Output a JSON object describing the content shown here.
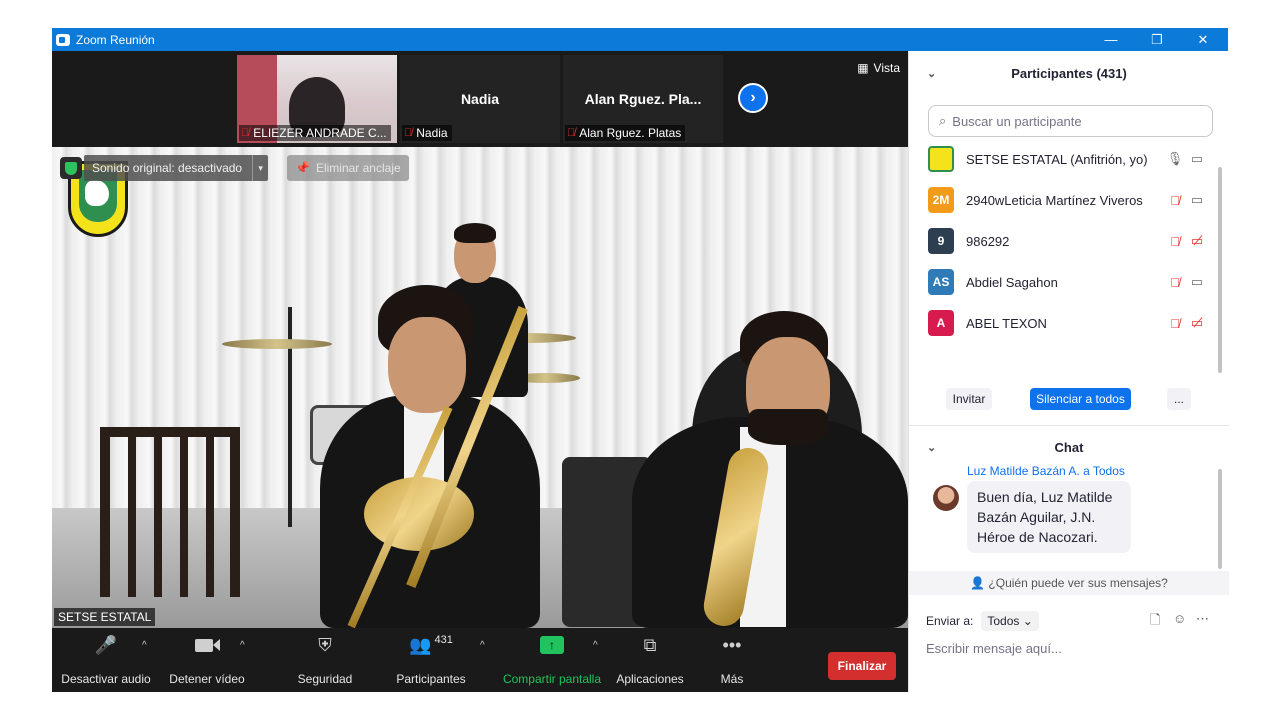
{
  "window": {
    "title": "Zoom Reunión",
    "minimize": "—",
    "restore": "❐",
    "close": "✕"
  },
  "strip": {
    "tiles": [
      {
        "name": "ELIEZER ANDRADE C...",
        "big": ""
      },
      {
        "name": "Nadia",
        "big": "Nadia"
      },
      {
        "name": "Alan  Rguez. Platas",
        "big": "Alan  Rguez. Pla..."
      }
    ],
    "next_icon": "›",
    "view_label": "Vista"
  },
  "video": {
    "original_sound": "Sonido original: desactivado",
    "dropdown_icon": "▾",
    "unpin_label": "Eliminar anclaje",
    "speaker_name": "SETSE ESTATAL"
  },
  "toolbar": {
    "audio": "Desactivar audio",
    "video": "Detener vídeo",
    "security": "Seguridad",
    "participants": "Participantes",
    "participants_count": "431",
    "share": "Compartir pantalla",
    "apps": "Aplicaciones",
    "more": "Más",
    "end": "Finalizar",
    "caret": "^"
  },
  "participants": {
    "header": "Participantes (431)",
    "search_placeholder": "Buscar un participante",
    "list": [
      {
        "initials": "",
        "name": "SETSE ESTATAL (Anfitrión, yo)",
        "color": "#f4e21a"
      },
      {
        "initials": "2M",
        "name": "2940wLeticia Martínez Viveros",
        "color": "#f29b1b"
      },
      {
        "initials": "9",
        "name": "986292",
        "color": "#2d3e50"
      },
      {
        "initials": "AS",
        "name": "Abdiel Sagahon",
        "color": "#2e7bb8"
      },
      {
        "initials": "A",
        "name": "ABEL TEXON",
        "color": "#d81b4e"
      }
    ],
    "invite": "Invitar",
    "mute_all": "Silenciar a todos",
    "more": "..."
  },
  "chat": {
    "header": "Chat",
    "sender_line": "Luz Matilde Bazán A. a Todos",
    "message": "Buen día, Luz Matilde Bazán Aguilar, J.N. Héroe de Nacozari.",
    "who_can_see": "¿Quién puede ver sus mensajes?",
    "send_to_label": "Enviar a:",
    "send_to_value": "Todos",
    "compose_placeholder": "Escribir mensaje aquí..."
  },
  "colors": {
    "titlebar": "#0b7ad8",
    "accent": "#0e72ed",
    "end": "#d32f2f",
    "share": "#20c35d",
    "muted": "#e5342f"
  }
}
